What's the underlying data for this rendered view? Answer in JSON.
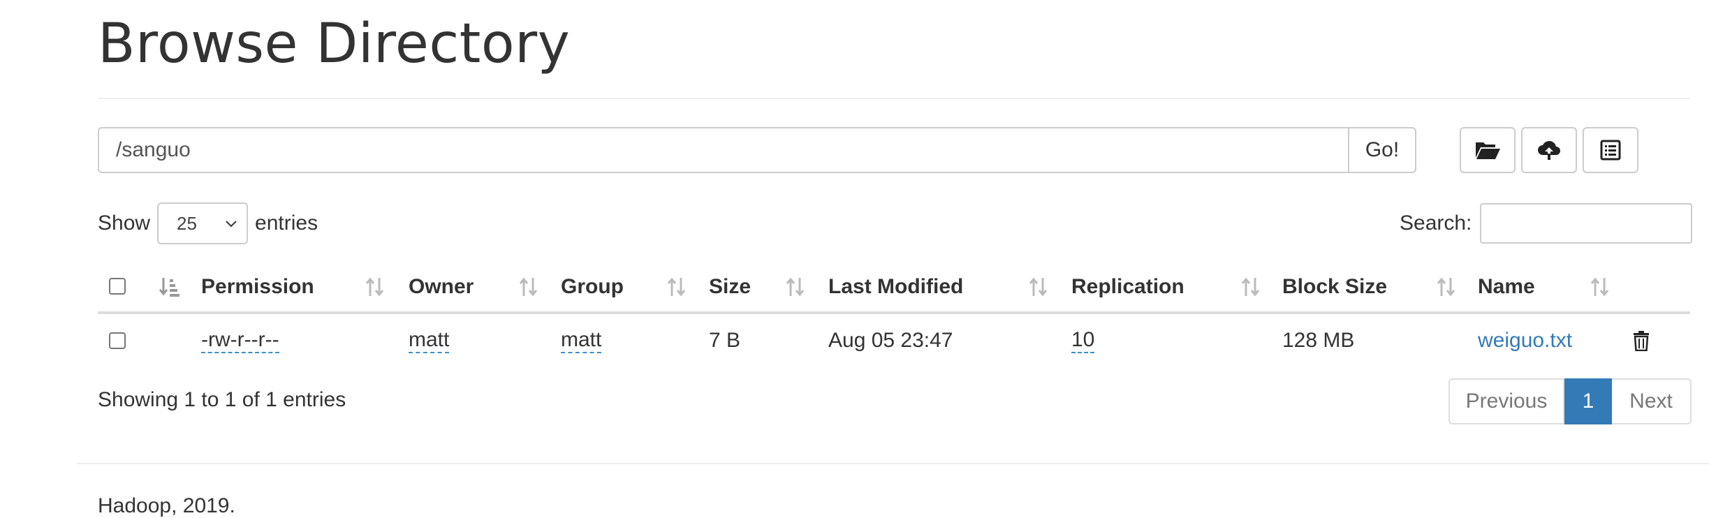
{
  "header": {
    "title": "Browse Directory"
  },
  "path_bar": {
    "value": "/sanguo",
    "go_label": "Go!"
  },
  "toolbar": {
    "icons": [
      "folder-open-icon",
      "cloud-upload-icon",
      "list-alt-icon"
    ]
  },
  "length_control": {
    "show_label": "Show",
    "selected": "25",
    "entries_label": "entries"
  },
  "search": {
    "label": "Search:",
    "value": ""
  },
  "table": {
    "columns": [
      "Permission",
      "Owner",
      "Group",
      "Size",
      "Last Modified",
      "Replication",
      "Block Size",
      "Name"
    ],
    "rows": [
      {
        "permission": "-rw-r--r--",
        "owner": "matt",
        "group": "matt",
        "size": "7 B",
        "last_modified": "Aug 05 23:47",
        "replication": "10",
        "block_size": "128 MB",
        "name": "weiguo.txt"
      }
    ]
  },
  "info": {
    "text": "Showing 1 to 1 of 1 entries"
  },
  "pagination": {
    "previous": "Previous",
    "current": "1",
    "next": "Next"
  },
  "footer": {
    "text": "Hadoop, 2019."
  },
  "colors": {
    "link": "#337ab7",
    "active_page": "#337ab7",
    "border": "#cccccc"
  }
}
